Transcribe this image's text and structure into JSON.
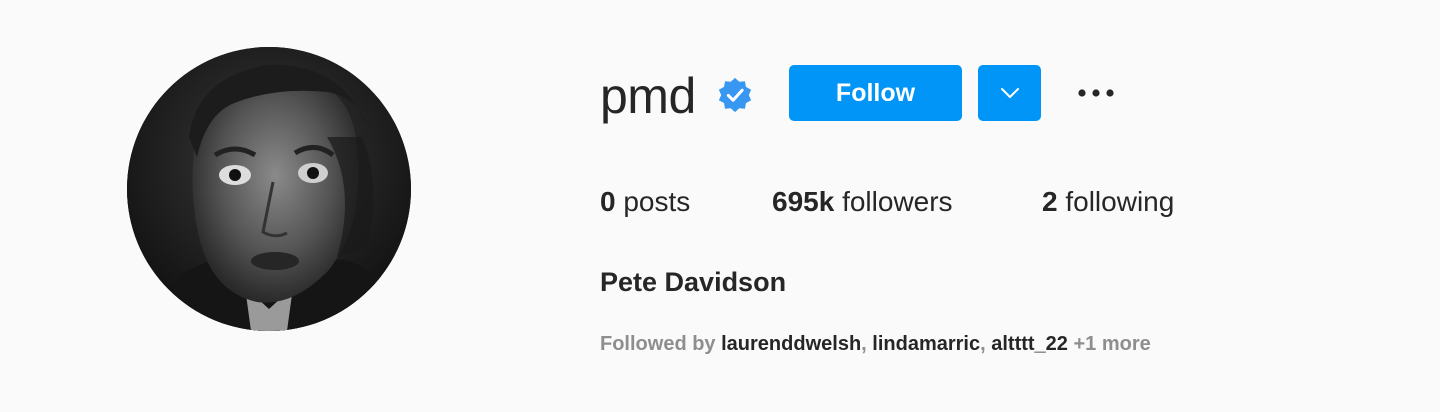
{
  "profile": {
    "username": "pmd",
    "verified": true,
    "full_name": "Pete Davidson",
    "avatar_description": "avatar-photo"
  },
  "actions": {
    "follow_label": "Follow",
    "dropdown_icon": "chevron-down-icon",
    "more_icon": "more-options-icon"
  },
  "stats": {
    "posts_count": "0",
    "posts_label": "posts",
    "followers_count": "695k",
    "followers_label": "followers",
    "following_count": "2",
    "following_label": "following"
  },
  "followed_by": {
    "prefix": "Followed by",
    "accounts": [
      "laurenddwelsh",
      "lindamarric",
      "altttt_22"
    ],
    "more": "+1 more"
  },
  "colors": {
    "accent": "#0095f6",
    "background": "#fafafa",
    "text": "#262626",
    "muted": "#8e8e8e"
  }
}
